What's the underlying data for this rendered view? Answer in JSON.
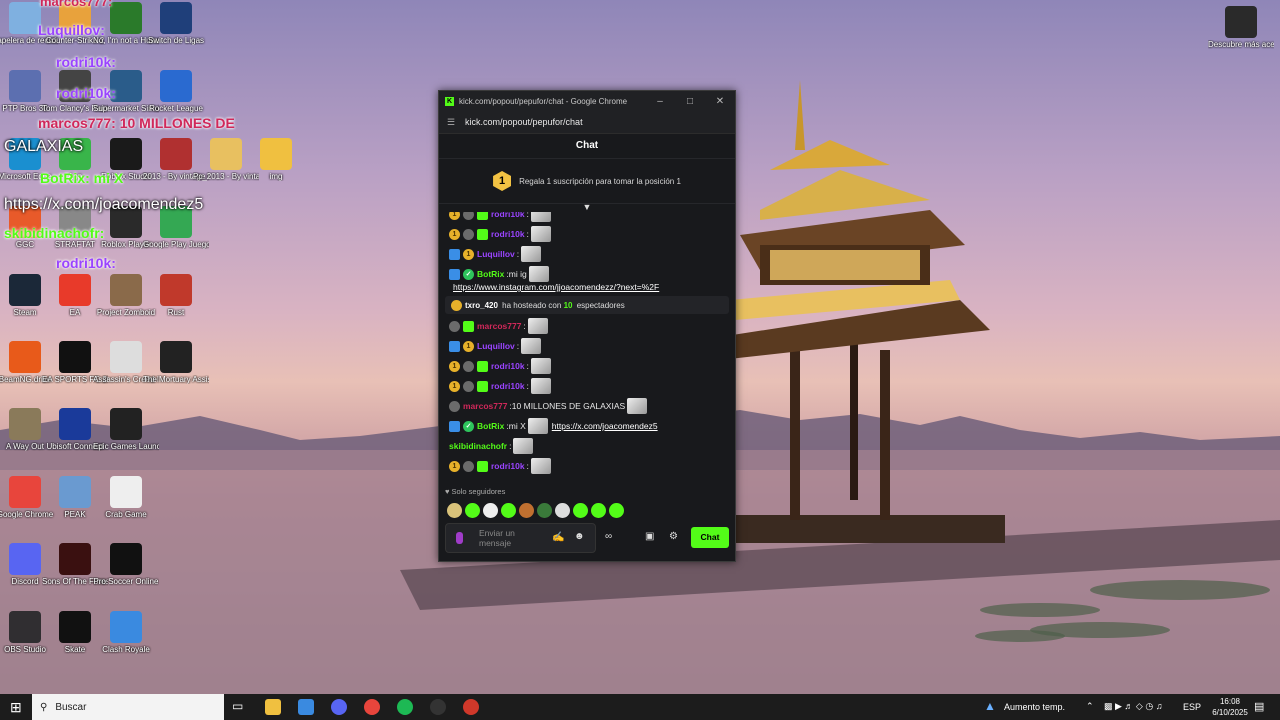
{
  "desktop": {
    "icons": [
      {
        "label": "Papelera de reciclaje",
        "color": "#7fb0e0"
      },
      {
        "label": "Counter-Strike 2",
        "color": "#e8a23c"
      },
      {
        "label": "No, I'm not a Human",
        "color": "#2a7a2a"
      },
      {
        "label": "Switch de Ligas",
        "color": "#1f3f7a"
      },
      {
        "label": "PTP Bros 30",
        "color": "#5c6fb0"
      },
      {
        "label": "Tom Clancy's Rainbow Six",
        "color": "#444"
      },
      {
        "label": "Supermarket Simulator",
        "color": "#2a5c8a"
      },
      {
        "label": "Rocket League",
        "color": "#2a6ad0"
      },
      {
        "label": "Microsoft Edge",
        "color": "#1a8fd0"
      },
      {
        "label": "App",
        "color": "#39b54a"
      },
      {
        "label": "Roblox Studio",
        "color": "#1a1a1a"
      },
      {
        "label": "2013 - By vintage Ga...",
        "color": "#b03030"
      },
      {
        "label": "Pc_2013 - By vintage Ga...",
        "color": "#e8c060"
      },
      {
        "label": "img",
        "color": "#f0c040"
      },
      {
        "label": "GGC",
        "color": "#e85a2a"
      },
      {
        "label": "STRAFTAT",
        "color": "#888"
      },
      {
        "label": "Roblox Player",
        "color": "#2a2a2a"
      },
      {
        "label": "Google Play Juegos Beta",
        "color": "#34a853"
      },
      {
        "label": "Steam",
        "color": "#1b2838"
      },
      {
        "label": "EA",
        "color": "#e83a2a"
      },
      {
        "label": "Project Zomboid",
        "color": "#8a6a4a"
      },
      {
        "label": "Rust",
        "color": "#c0392b"
      },
      {
        "label": "BeamNG.drive",
        "color": "#e85a1a"
      },
      {
        "label": "EA SPORTS FC 26",
        "color": "#111"
      },
      {
        "label": "Assassin's Creed I",
        "color": "#ddd"
      },
      {
        "label": "The Mortuary Assistant",
        "color": "#222"
      },
      {
        "label": "A Way Out",
        "color": "#8a7a5a"
      },
      {
        "label": "Ubisoft Connect",
        "color": "#1a3a9a"
      },
      {
        "label": "Epic Games Launcher",
        "color": "#222"
      },
      {
        "label": "Google Chrome",
        "color": "#e8453c"
      },
      {
        "label": "PEAK",
        "color": "#6a9ad0"
      },
      {
        "label": "Crab Game",
        "color": "#eee"
      },
      {
        "label": "Discord",
        "color": "#5865f2"
      },
      {
        "label": "Sons Of The Forest",
        "color": "#3a1010"
      },
      {
        "label": "Pro Soccer Online",
        "color": "#111"
      },
      {
        "label": "OBS Studio",
        "color": "#302e31"
      },
      {
        "label": "Skate",
        "color": "#111"
      },
      {
        "label": "Clash Royale",
        "color": "#3a8ae0"
      },
      {
        "label": "Descubre más acerca...",
        "color": "#2a2a2a"
      }
    ]
  },
  "overlay": {
    "lines": [
      {
        "text": "marcos777:",
        "color": "#d0285a"
      },
      {
        "text": "Luquillov:",
        "color": "#9a44ff"
      },
      {
        "text": "rodri10k:",
        "color": "#9a44ff"
      },
      {
        "text": "rodri10k:",
        "color": "#9a44ff"
      },
      {
        "text": "marcos777: 10 MILLONES DE",
        "color": "#d0285a"
      },
      {
        "text": "GALAXIAS",
        "color": "#ffffff"
      },
      {
        "text": "BotRix: mi X",
        "color": "#53fc18"
      },
      {
        "text": "https://x.com/joacomendez5",
        "color": "#ffffff"
      },
      {
        "text": "skibidinachofr:",
        "color": "#53fc18"
      },
      {
        "text": "rodri10k:",
        "color": "#9a44ff"
      }
    ]
  },
  "browser": {
    "title": "kick.com/popout/pepufor/chat - Google Chrome",
    "url": "kick.com/popout/pepufor/chat",
    "chat_header": "Chat",
    "sub_rank": "1",
    "sub_text": "Regala 1 suscripción para tomar la posición 1",
    "messages": [
      {
        "badges": [
          "coin",
          "moon",
          "grn"
        ],
        "user": "rodri10k",
        "color": "#9a44ff",
        "text": "",
        "emote": true
      },
      {
        "badges": [
          "coin",
          "moon",
          "grn"
        ],
        "user": "rodri10k",
        "color": "#9a44ff",
        "text": "",
        "emote": true
      },
      {
        "badges": [
          "blue",
          "coin"
        ],
        "user": "Luquillov",
        "color": "#9a44ff",
        "text": "",
        "emote": true
      },
      {
        "badges": [
          "blue",
          "ver"
        ],
        "user": "BotRix",
        "color": "#53fc18",
        "text": " mi ig",
        "emote": true
      },
      {
        "badges": [],
        "user": "",
        "color": "#fff",
        "text": "",
        "link": "https://www.instagram.com/jjoacomendezz/?next=%2F"
      },
      {
        "host": true,
        "user": "txro_420",
        "pre": "ha hosteado con",
        "count": "10",
        "post": "espectadores"
      },
      {
        "badges": [
          "moon",
          "grn"
        ],
        "user": "marcos777",
        "color": "#d0285a",
        "text": "",
        "emote": true
      },
      {
        "badges": [
          "blue",
          "coin"
        ],
        "user": "Luquillov",
        "color": "#9a44ff",
        "text": "",
        "emote": true
      },
      {
        "badges": [
          "coin",
          "moon",
          "grn"
        ],
        "user": "rodri10k",
        "color": "#9a44ff",
        "text": "",
        "emote": true
      },
      {
        "badges": [
          "coin",
          "moon",
          "grn"
        ],
        "user": "rodri10k",
        "color": "#9a44ff",
        "text": "",
        "emote": true
      },
      {
        "badges": [
          "moon"
        ],
        "user": "marcos777",
        "color": "#d0285a",
        "text": " 10 MILLONES DE GALAXIAS",
        "emote": true
      },
      {
        "badges": [
          "blue",
          "ver"
        ],
        "user": "BotRix",
        "color": "#53fc18",
        "text": " mi X",
        "emote": true,
        "link": "https://x.com/joacomendez5"
      },
      {
        "badges": [],
        "user": "skibidinachofr",
        "color": "#53fc18",
        "text": "",
        "emote": true
      },
      {
        "badges": [
          "coin",
          "moon",
          "grn"
        ],
        "user": "rodri10k",
        "color": "#9a44ff",
        "text": "",
        "emote": true
      }
    ],
    "followers_only": "Solo seguidores",
    "input_placeholder": "Enviar un mensaje",
    "send_label": "Chat"
  },
  "taskbar": {
    "search_placeholder": "Buscar",
    "weather": "Aumento temp.",
    "lang": "ESP",
    "time": "16:08",
    "date": "6/10/2025"
  }
}
